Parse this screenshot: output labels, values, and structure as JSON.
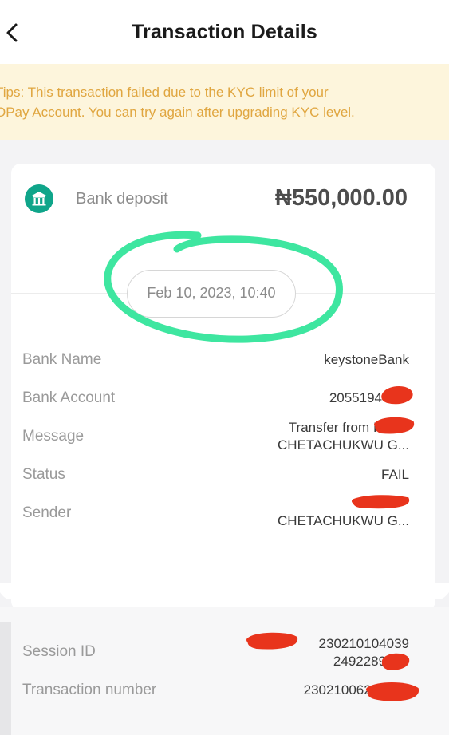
{
  "header": {
    "title": "Transaction Details"
  },
  "tips": {
    "line1": "Tips: This transaction failed due to the KYC limit of your",
    "line2": "OPay Account. You can try again after upgrading KYC level."
  },
  "transaction": {
    "type_label": "Bank deposit",
    "amount": "₦550,000.00",
    "datetime": "Feb 10, 2023, 10:40"
  },
  "details": {
    "bank_name": {
      "label": "Bank Name",
      "value": "keystoneBank"
    },
    "bank_account": {
      "label": "Bank Account",
      "value": "2055194"
    },
    "message": {
      "label": "Message",
      "value_line1": "Transfer from IF",
      "value_line2": "CHETACHUKWU G..."
    },
    "status": {
      "label": "Status",
      "value": "FAIL"
    },
    "sender": {
      "label": "Sender",
      "value_line2": "CHETACHUKWU G..."
    },
    "session_id": {
      "label": "Session ID",
      "value_line1": "230210104039",
      "value_line2": "249228923"
    },
    "transaction_number": {
      "label": "Transaction number",
      "value": "23021006244416"
    }
  },
  "icons": {
    "back": "chevron-left-icon",
    "bank": "bank-icon"
  },
  "colors": {
    "accent": "#0fa58a",
    "tips_text": "#e0a640",
    "tips_bg": "#fdf5dc",
    "highlight": "#3ee6a0",
    "redaction": "#e8341c"
  }
}
